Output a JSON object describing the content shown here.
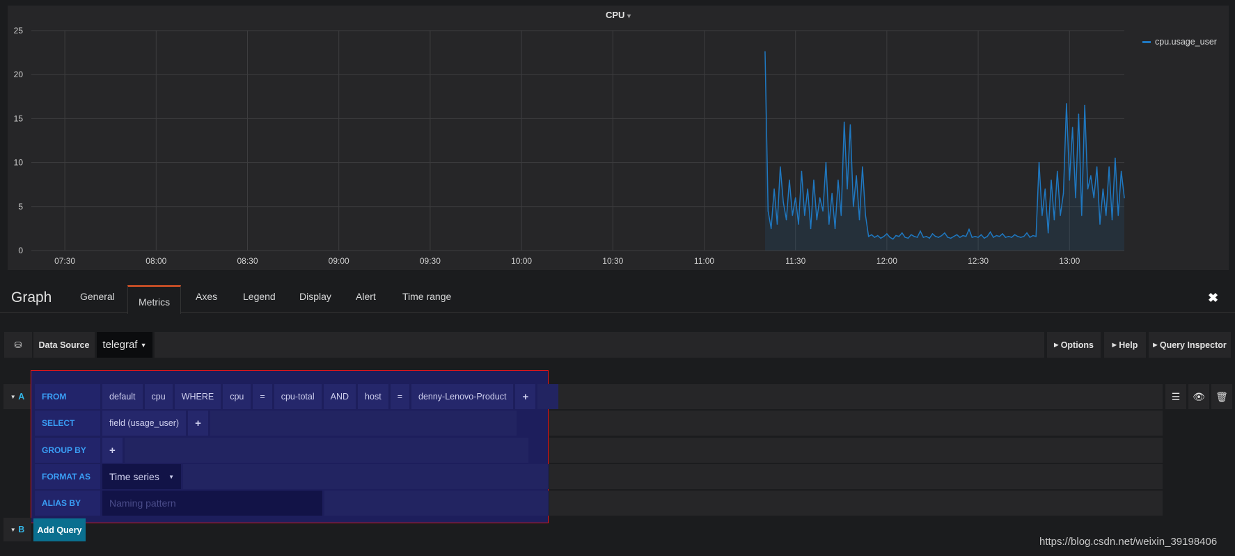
{
  "panel": {
    "title": "CPU",
    "title_caret": "▾",
    "legend": "cpu.usage_user",
    "series_color": "#1f78c1"
  },
  "chart_data": {
    "type": "area",
    "title": "CPU",
    "xlabel": "",
    "ylabel": "",
    "xlim": [
      "07:19",
      "13:18"
    ],
    "ylim": [
      0,
      25
    ],
    "y_ticks": [
      0,
      5,
      10,
      15,
      20,
      25
    ],
    "x_ticks": [
      "07:30",
      "08:00",
      "08:30",
      "09:00",
      "09:30",
      "10:00",
      "10:30",
      "11:00",
      "11:30",
      "12:00",
      "12:30",
      "13:00"
    ],
    "grid": true,
    "legend_position": "right",
    "series": [
      {
        "name": "cpu.usage_user",
        "color": "#1f78c1",
        "x": [
          "11:20",
          "11:21",
          "11:22",
          "11:23",
          "11:24",
          "11:25",
          "11:26",
          "11:27",
          "11:28",
          "11:29",
          "11:30",
          "11:31",
          "11:32",
          "11:33",
          "11:34",
          "11:35",
          "11:36",
          "11:37",
          "11:38",
          "11:39",
          "11:40",
          "11:41",
          "11:42",
          "11:43",
          "11:44",
          "11:45",
          "11:46",
          "11:47",
          "11:48",
          "11:49",
          "11:50",
          "11:51",
          "11:52",
          "11:53",
          "11:54",
          "11:55",
          "11:56",
          "11:57",
          "11:58",
          "11:59",
          "12:00",
          "12:01",
          "12:02",
          "12:03",
          "12:04",
          "12:05",
          "12:06",
          "12:07",
          "12:08",
          "12:09",
          "12:10",
          "12:11",
          "12:12",
          "12:13",
          "12:14",
          "12:15",
          "12:16",
          "12:17",
          "12:18",
          "12:19",
          "12:20",
          "12:21",
          "12:22",
          "12:23",
          "12:24",
          "12:25",
          "12:26",
          "12:27",
          "12:28",
          "12:29",
          "12:30",
          "12:31",
          "12:32",
          "12:33",
          "12:34",
          "12:35",
          "12:36",
          "12:37",
          "12:38",
          "12:39",
          "12:40",
          "12:41",
          "12:42",
          "12:43",
          "12:44",
          "12:45",
          "12:46",
          "12:47",
          "12:48",
          "12:49",
          "12:50",
          "12:51",
          "12:52",
          "12:53",
          "12:54",
          "12:55",
          "12:56",
          "12:57",
          "12:58",
          "12:59",
          "13:00",
          "13:01",
          "13:02",
          "13:03",
          "13:04",
          "13:05",
          "13:06",
          "13:07",
          "13:08",
          "13:09",
          "13:10",
          "13:11",
          "13:12",
          "13:13",
          "13:14",
          "13:15",
          "13:16",
          "13:17",
          "13:18"
        ],
        "values": [
          22.6,
          4.5,
          2.5,
          7,
          3,
          9.5,
          5.5,
          3.5,
          8,
          4,
          6,
          3,
          9,
          4,
          7,
          2.5,
          8,
          3.5,
          6,
          4.5,
          10,
          3,
          6.5,
          2.5,
          8,
          4,
          14.6,
          7,
          14.3,
          5,
          8.5,
          3.5,
          9.5,
          4,
          1.6,
          1.8,
          1.5,
          1.7,
          1.4,
          1.6,
          1.9,
          1.5,
          1.3,
          1.7,
          1.6,
          2.0,
          1.5,
          1.4,
          1.8,
          1.6,
          1.5,
          2.2,
          1.5,
          1.6,
          1.4,
          1.9,
          1.6,
          1.5,
          1.7,
          2.0,
          1.5,
          1.4,
          1.6,
          1.8,
          1.5,
          1.7,
          1.6,
          2.4,
          1.5,
          1.6,
          1.5,
          1.8,
          1.4,
          1.6,
          2.1,
          1.5,
          1.7,
          1.6,
          1.9,
          1.5,
          1.6,
          1.5,
          1.8,
          1.6,
          1.5,
          1.6,
          2.0,
          1.5,
          1.7,
          1.6,
          10,
          4,
          7,
          2,
          8,
          3.5,
          9,
          4,
          6.5,
          16.7,
          8,
          14,
          6,
          15.5,
          4,
          16.5,
          7,
          8.5,
          6,
          9.5,
          3,
          7,
          4,
          9.5,
          3.5,
          10.5,
          4,
          9,
          6
        ]
      }
    ]
  },
  "editor": {
    "title": "Graph",
    "tabs": [
      "General",
      "Metrics",
      "Axes",
      "Legend",
      "Display",
      "Alert",
      "Time range"
    ],
    "active_tab": "Metrics",
    "close": "✖",
    "data_source_label": "Data Source",
    "data_source_value": "telegraf",
    "options": "Options",
    "help": "Help",
    "inspector": "Query Inspector",
    "query_a": {
      "letter": "A",
      "from_label": "FROM",
      "from": [
        "default",
        "cpu"
      ],
      "where": "WHERE",
      "tag1": "cpu",
      "eq": "=",
      "val1": "cpu-total",
      "and": "AND",
      "tag2": "host",
      "val2": "denny-Lenovo-Product",
      "plus": "+",
      "select_label": "SELECT",
      "select": "field (usage_user)",
      "group_label": "GROUP BY",
      "format_label": "FORMAT AS",
      "format": "Time series",
      "alias_label": "ALIAS BY",
      "alias_placeholder": "Naming pattern"
    },
    "query_b": {
      "letter": "B"
    },
    "add_query": "Add Query"
  },
  "watermark": "https://blog.csdn.net/weixin_39198406"
}
